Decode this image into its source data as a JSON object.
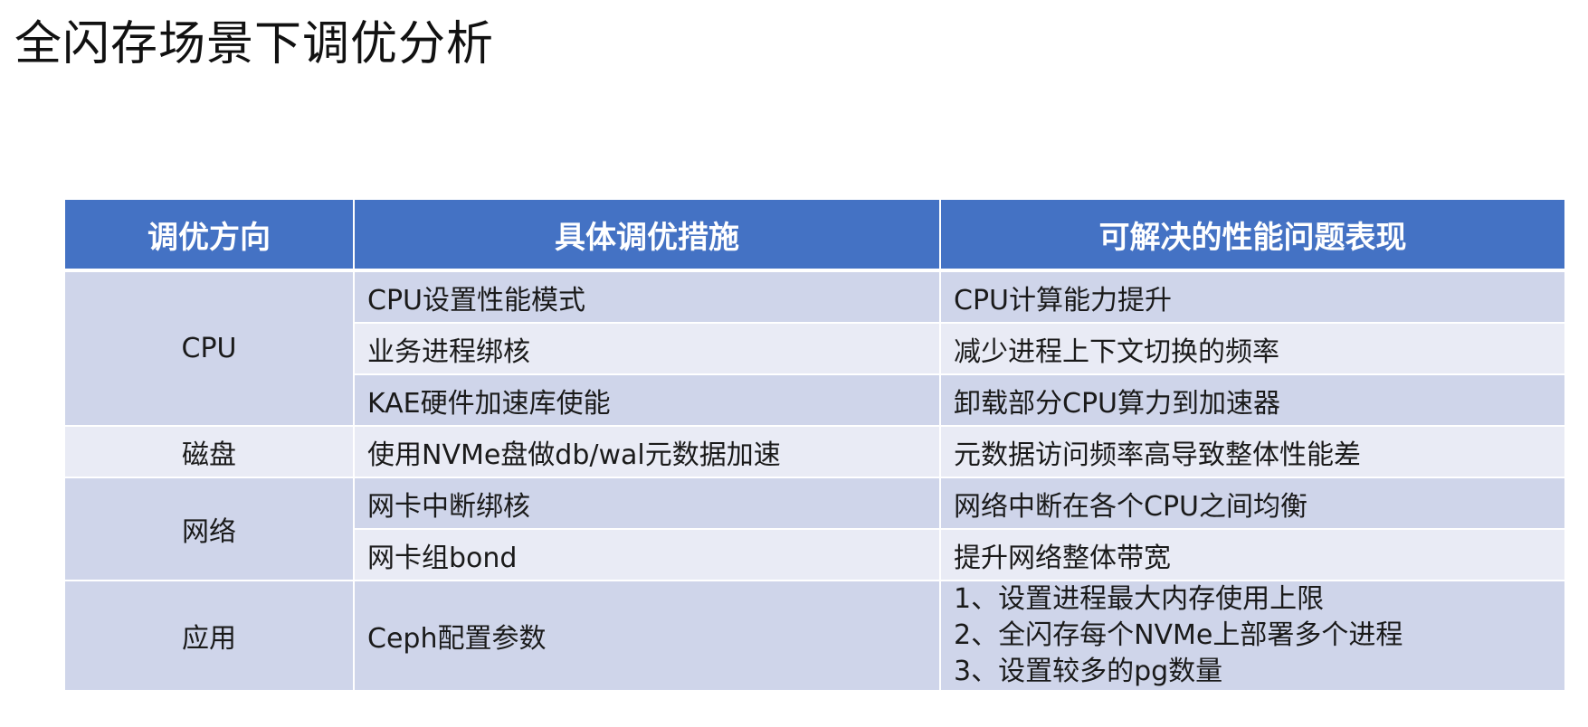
{
  "title": "全闪存场景下调优分析",
  "table": {
    "headers": [
      "调优方向",
      "具体调优措施",
      "可解决的性能问题表现"
    ],
    "rows": [
      {
        "category": "CPU",
        "measure": "CPU设置性能模式",
        "effect": "CPU计算能力提升"
      },
      {
        "category": "",
        "measure": "业务进程绑核",
        "effect": "减少进程上下文切换的频率"
      },
      {
        "category": "",
        "measure": "KAE硬件加速库使能",
        "effect": "卸载部分CPU算力到加速器"
      },
      {
        "category": "磁盘",
        "measure": "使用NVMe盘做db/wal元数据加速",
        "effect": "元数据访问频率高导致整体性能差"
      },
      {
        "category": "网络",
        "measure": "网卡中断绑核",
        "effect": "网络中断在各个CPU之间均衡"
      },
      {
        "category": "",
        "measure": "网卡组bond",
        "effect": "提升网络整体带宽"
      },
      {
        "category": "应用",
        "measure": "Ceph配置参数",
        "effect_lines": [
          "1、设置进程最大内存使用上限",
          "2、全闪存每个NVMe上部署多个进程",
          "3、设置较多的pg数量"
        ]
      }
    ]
  },
  "colors": {
    "header_bg": "#4472c4",
    "row_dark": "#cfd5ea",
    "row_light": "#e9ebf5"
  }
}
